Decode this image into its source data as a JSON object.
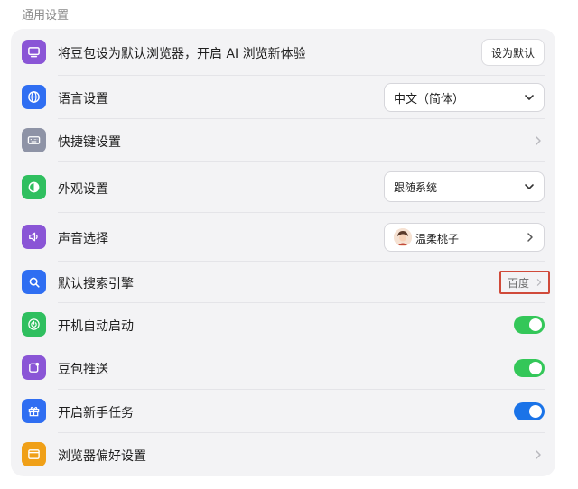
{
  "section": {
    "title": "通用设置"
  },
  "rows": [
    {
      "label": "将豆包设为默认浏览器，开启 AI 浏览新体验",
      "button": "设为默认",
      "icon": "monitor-icon",
      "color": "#8a55d6"
    },
    {
      "label": "语言设置",
      "select": "中文（简体）",
      "icon": "globe-icon",
      "color": "#2f6ef2"
    },
    {
      "label": "快捷键设置",
      "icon": "keyboard-icon",
      "color": "#8e93a6"
    },
    {
      "label": "外观设置",
      "select": "跟随系统",
      "icon": "half-circle-icon",
      "color": "#2fbf5f"
    },
    {
      "label": "声音选择",
      "voice": "温柔桃子",
      "icon": "speaker-icon",
      "color": "#8a55d6"
    },
    {
      "label": "默认搜索引擎",
      "engine": "百度",
      "icon": "search-icon",
      "color": "#2f6ef2"
    },
    {
      "label": "开机自动启动",
      "toggle": true,
      "icon": "power-icon",
      "color": "#2fbf5f"
    },
    {
      "label": "豆包推送",
      "toggle": true,
      "icon": "notification-icon",
      "color": "#8a55d6"
    },
    {
      "label": "开启新手任务",
      "toggle": true,
      "icon": "gift-icon",
      "color": "#2f6ef2"
    },
    {
      "label": "浏览器偏好设置",
      "icon": "browser-window-icon",
      "color": "#f0a018"
    }
  ],
  "colors": {
    "toggle_green": "#34c759",
    "toggle_blue": "#1a73e8",
    "highlight_border": "#d04a3a"
  }
}
